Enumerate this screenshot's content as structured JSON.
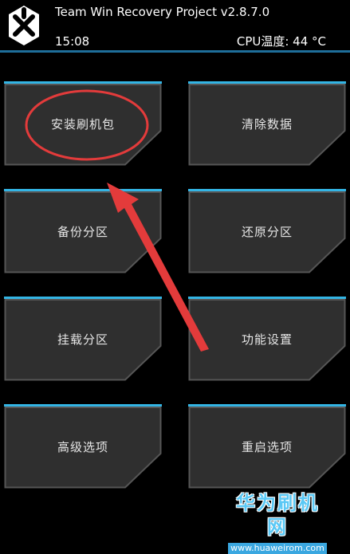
{
  "header": {
    "title": "Team Win Recovery Project  v2.8.7.0",
    "time": "15:08",
    "cpu_temp": "CPU温度: 44 °C"
  },
  "menu": {
    "install": "安装刷机包",
    "wipe": "清除数据",
    "backup": "备份分区",
    "restore": "还原分区",
    "mount": "挂载分区",
    "settings": "功能设置",
    "advanced": "高级选项",
    "reboot": "重启选项"
  },
  "watermark": {
    "text": "华为刷机网",
    "url": "www.huaweirom.com"
  },
  "colors": {
    "accent": "#33b5e5",
    "tile_fill": "#2f2f2f",
    "tile_border": "#555555",
    "annotation": "#e33b3b"
  }
}
